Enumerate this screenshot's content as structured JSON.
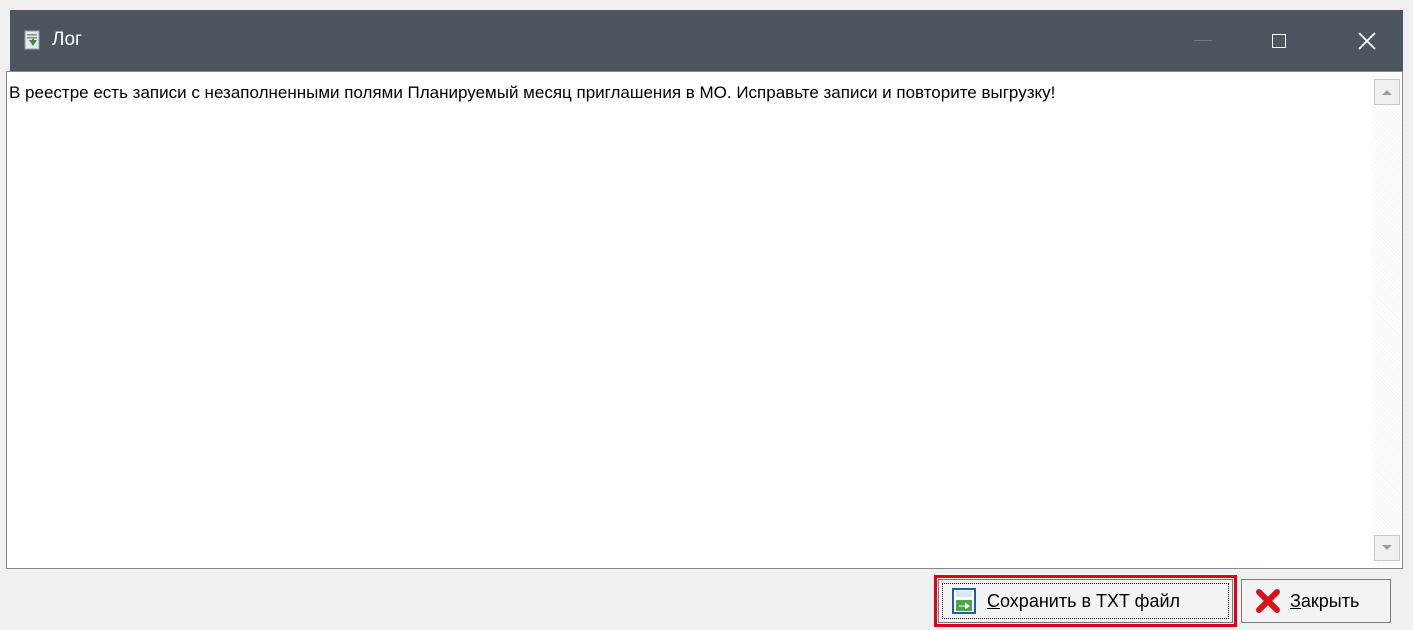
{
  "window": {
    "title": "Лог",
    "icon": "log-document-icon"
  },
  "titlebar": {
    "minimize_icon": "minimize-icon",
    "maximize_icon": "maximize-icon",
    "close_icon": "close-icon"
  },
  "log": {
    "text": "В реестре есть записи с незаполненными полями Планируемый месяц приглашения в МО. Исправьте записи и повторите выгрузку!"
  },
  "scrollbar": {
    "up_icon": "scroll-up-arrow-icon",
    "down_icon": "scroll-down-arrow-icon"
  },
  "buttons": {
    "save": {
      "mnemonic": "С",
      "rest": "охранить в TXT файл",
      "icon": "save-export-icon",
      "highlight_color": "#e0001a"
    },
    "close": {
      "mnemonic": "З",
      "rest": "акрыть",
      "icon": "red-x-icon"
    }
  },
  "colors": {
    "titlebar_bg": "#4d565e",
    "window_bg": "#f0f0f0"
  }
}
